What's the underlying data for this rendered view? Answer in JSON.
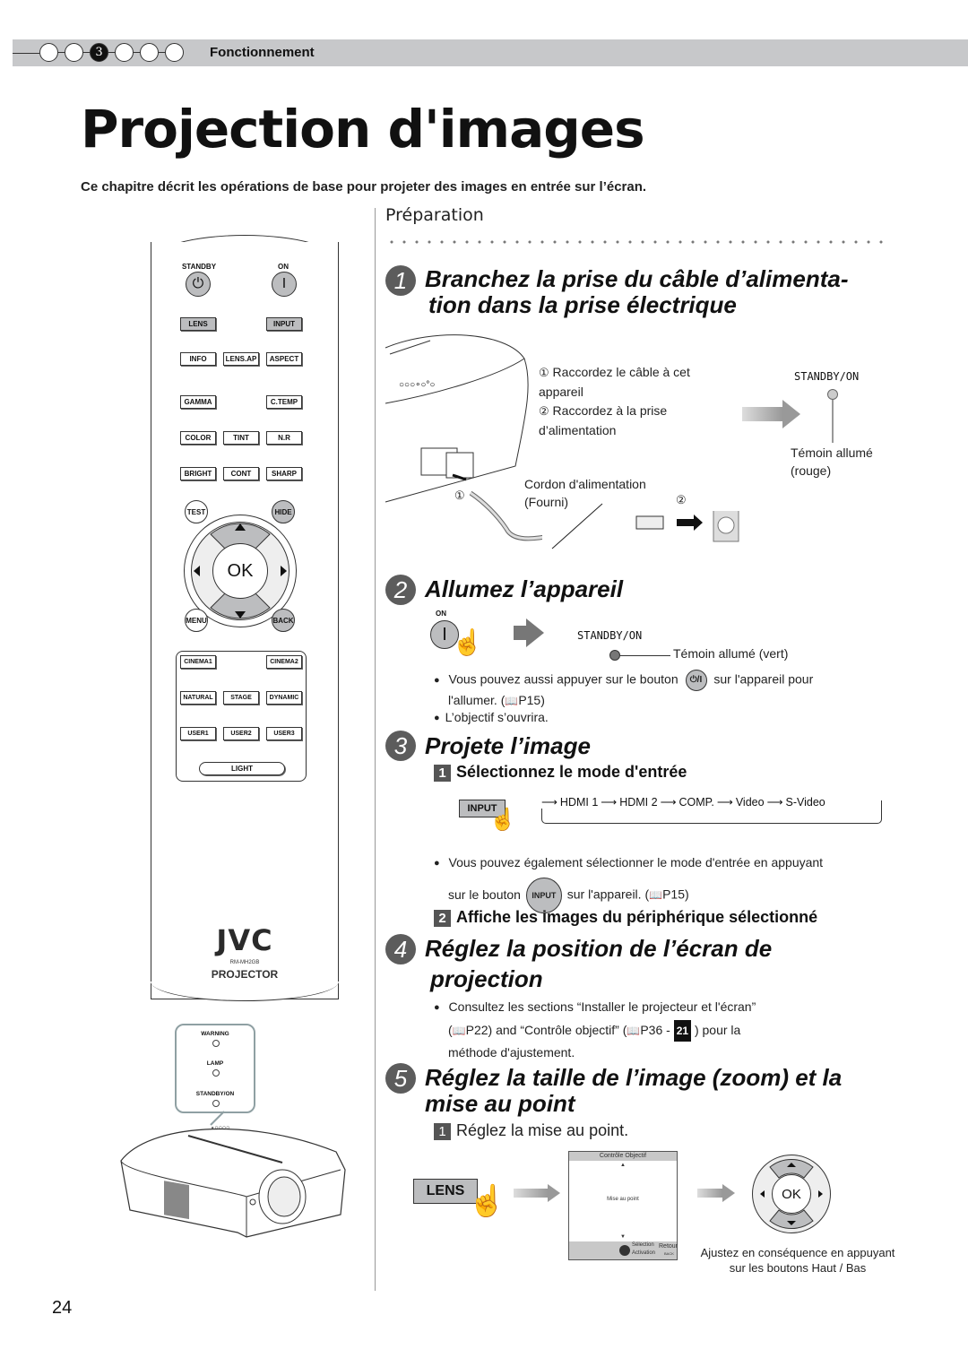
{
  "header": {
    "chapter_steps": [
      "",
      "",
      "3",
      "",
      "",
      ""
    ],
    "active_step_index": 2,
    "section": "Fonctionnement"
  },
  "title": "Projection d'images",
  "intro": "Ce chapitre décrit les opérations de base pour projeter des images en entrée sur l’écran.",
  "preparation_label": "Préparation",
  "remote": {
    "standby_label": "STANDBY",
    "on_label": "ON",
    "standby_glyph": "⏻",
    "on_glyph": "I",
    "rows": [
      [
        "LENS",
        "",
        "INPUT"
      ],
      [
        "INFO",
        "LENS.AP",
        "ASPECT"
      ],
      [
        "GAMMA",
        "",
        "C.TEMP"
      ],
      [
        "COLOR",
        "TINT",
        "N.R"
      ],
      [
        "BRIGHT",
        "CONT",
        "SHARP"
      ]
    ],
    "corner_buttons": {
      "test": "TEST",
      "hide": "HIDE",
      "menu": "MENU",
      "back": "BACK"
    },
    "ok": "OK",
    "mode_rows": [
      [
        "CINEMA1",
        "",
        "CINEMA2"
      ],
      [
        "NATURAL",
        "STAGE",
        "DYNAMIC"
      ],
      [
        "USER1",
        "USER2",
        "USER3"
      ]
    ],
    "light": "LIGHT",
    "brand": "JVC",
    "model": "RM-MH2GB",
    "product": "PROJECTOR"
  },
  "indicators": {
    "warning": "WARNING",
    "lamp": "LAMP",
    "standby_on": "STANDBY/ON"
  },
  "step1": {
    "num": "1",
    "title_line1": "Branchez la prise du câble d’alimenta-",
    "title_line2": "tion dans la prise électrique",
    "item1_num": "①",
    "item1": "Raccordez le câble à cet appareil",
    "item2_num": "②",
    "item2": "Raccordez à la prise d’alimentation",
    "cord_line1": "Cordon d'alimentation",
    "cord_line2": "(Fourni)",
    "marker1": "①",
    "marker2": "②",
    "standby_on": "STANDBY/ON",
    "lamp_line1": "Témoin allumé",
    "lamp_line2": "(rouge)"
  },
  "step2": {
    "num": "2",
    "title": "Allumez l’appareil",
    "on_label": "ON",
    "standby_on": "STANDBY/ON",
    "lamp": "Témoin allumé (vert)",
    "bullet1_a": "Vous pouvez aussi appuyer sur le bouton",
    "bullet1_btn": "⏻/I",
    "bullet1_b": "sur l'appareil pour",
    "bullet1_c": "l'allumer. (",
    "bullet1_ref": "P15",
    "bullet1_d": ")",
    "bullet2": "L’objectif s’ouvrira."
  },
  "step3": {
    "num": "3",
    "title": "Projete l’image",
    "sub1_num": "1",
    "sub1": "Sélectionnez le mode d'entrée",
    "input_key": "INPUT",
    "sequence": [
      "HDMI 1",
      "HDMI 2",
      "COMP.",
      "Video",
      "S-Video"
    ],
    "bullet_a": "Vous pouvez également sélectionner le mode d'entrée en appuyant",
    "bullet_b": "sur le bouton",
    "bullet_btn": "INPUT",
    "bullet_c": "sur l'appareil. (",
    "bullet_ref": "P15",
    "bullet_d": ")",
    "sub2_num": "2",
    "sub2": "Affiche les images du périphérique sélectionné"
  },
  "step4": {
    "num": "4",
    "title_line1": "Réglez la position de l’écran de",
    "title_line2": "projection",
    "bullet_a": "Consultez les sections “Installer le projecteur et l'écran”",
    "ref1_open": "(",
    "ref1": "P22",
    "mid": ") and “Contrôle objectif” (",
    "ref2": "P36",
    "dash": " - ",
    "badge": "21",
    "end": " ) pour la",
    "bullet_c": "méthode d'ajustement."
  },
  "step5": {
    "num": "5",
    "title_line1": "Réglez la taille de l’image (zoom) et la",
    "title_line2": "mise au point",
    "sub1_num": "1",
    "sub1": "Réglez la mise au point.",
    "lens_key": "LENS",
    "osd": {
      "title": "Contrôle Objectif",
      "body": "Mise au point",
      "select": "Sélection",
      "activate": "Activation",
      "back": "Retour",
      "back_key": "BACK"
    },
    "ok": "OK",
    "caption_line1": "Ajustez en conséquence en appuyant",
    "caption_line2": "sur les boutons Haut / Bas"
  },
  "page_number": "24"
}
